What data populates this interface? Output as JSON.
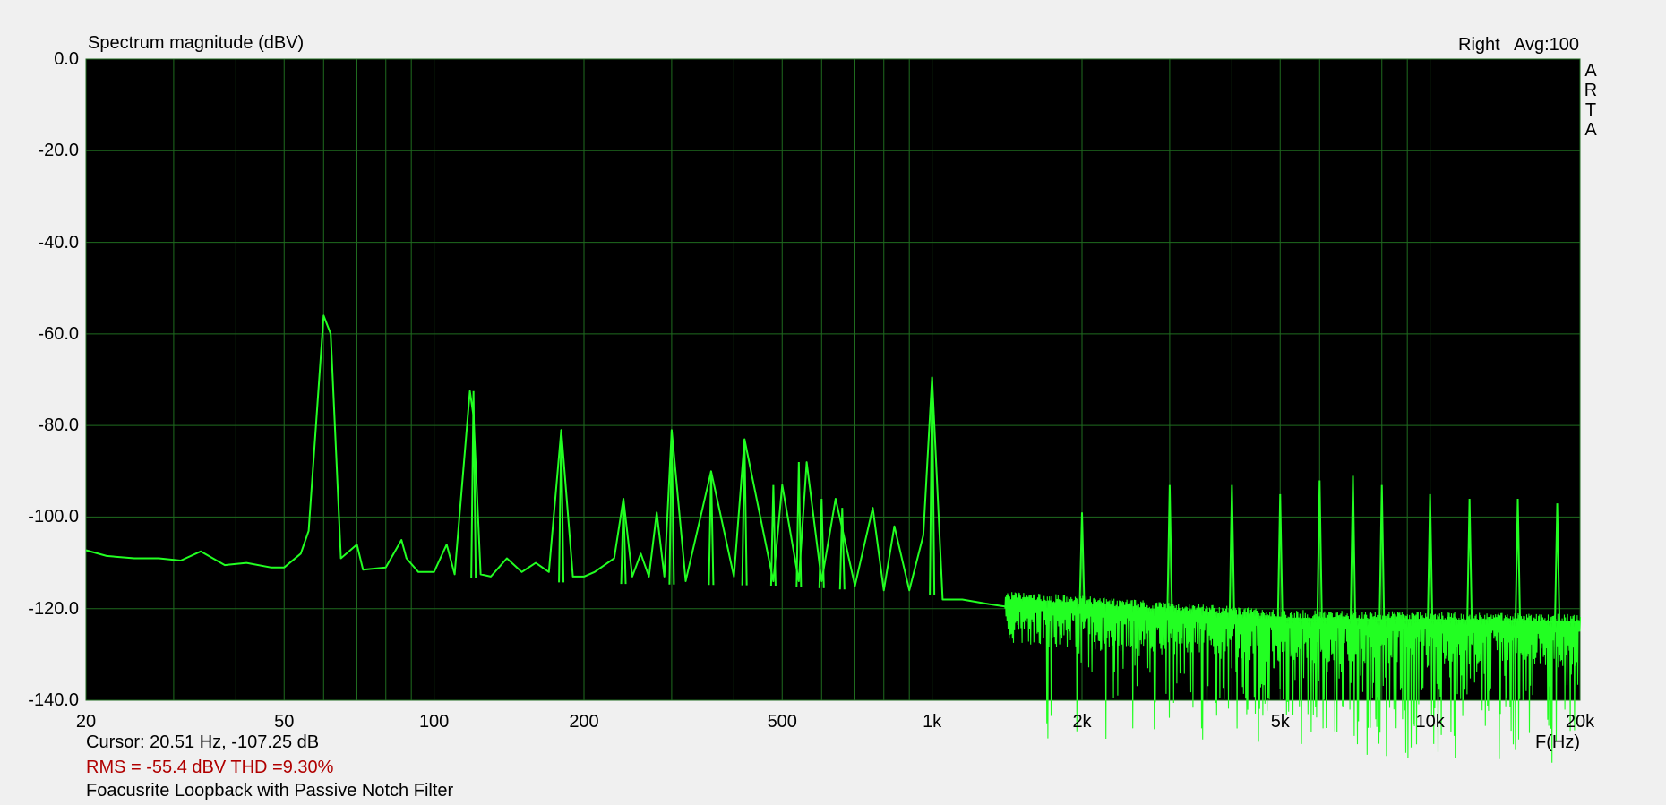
{
  "title": "Spectrum magnitude (dBV)",
  "channel_label": "Right",
  "avg_label": "Avg:100",
  "watermark_letters": [
    "A",
    "R",
    "T",
    "A"
  ],
  "cursor_text": "Cursor: 20.51 Hz, -107.25 dB",
  "rms_thd_text": "RMS =  -55.4 dBV  THD =9.30%",
  "measurement_name": "Foacusrite Loopback with Passive Notch Filter",
  "colors": {
    "plot_background": "#000000",
    "grid": "#1f6b1f",
    "trace": "#22ff22",
    "rms_text": "#b00000"
  },
  "chart_data": {
    "type": "line",
    "title": "Spectrum magnitude (dBV)",
    "xlabel": "F(Hz)",
    "ylabel": "",
    "x_scale": "log",
    "xlim": [
      20,
      20000
    ],
    "ylim": [
      -140,
      0
    ],
    "y_ticks": [
      0,
      -20,
      -40,
      -60,
      -80,
      -100,
      -120,
      -140
    ],
    "y_tick_labels": [
      "0.0",
      "-20.0",
      "-40.0",
      "-60.0",
      "-80.0",
      "-100.0",
      "-120.0",
      "-140.0"
    ],
    "x_tick_values": [
      20,
      50,
      100,
      200,
      500,
      1000,
      2000,
      5000,
      10000,
      20000
    ],
    "x_tick_labels": [
      "20",
      "50",
      "100",
      "200",
      "500",
      "1k",
      "2k",
      "5k",
      "10k",
      "20k"
    ],
    "grid": true,
    "noise_floor": [
      [
        20,
        -108.5
      ],
      [
        25,
        -109
      ],
      [
        30,
        -110
      ],
      [
        40,
        -110.5
      ],
      [
        50,
        -111
      ],
      [
        100,
        -113
      ],
      [
        200,
        -114.5
      ],
      [
        500,
        -115
      ],
      [
        1000,
        -117
      ],
      [
        2000,
        -119
      ],
      [
        5000,
        -122
      ],
      [
        10000,
        -122.5
      ],
      [
        20000,
        -123
      ]
    ],
    "series": [
      {
        "name": "",
        "x": [
          20,
          22,
          25,
          28,
          31,
          34,
          38,
          42,
          47,
          50,
          54,
          56,
          60,
          62,
          65,
          70,
          72,
          80,
          86,
          88,
          93,
          100,
          106,
          110,
          118,
          120,
          124,
          130,
          140,
          150,
          160,
          170,
          180,
          190,
          200,
          210,
          230,
          240,
          250,
          260,
          270,
          280,
          290,
          300,
          320,
          360,
          400,
          420,
          480,
          500,
          540,
          560,
          600,
          640,
          700,
          760,
          800,
          840,
          900,
          960,
          1000,
          1050,
          1150,
          1300,
          1500,
          2000,
          3000,
          5000,
          10000,
          20000
        ],
        "y": [
          -107.25,
          -108.5,
          -109,
          -109,
          -109.5,
          -107.5,
          -110.5,
          -110,
          -111,
          -111,
          -108,
          -103,
          -56,
          -60,
          -109,
          -106,
          -111.5,
          -111,
          -105,
          -109,
          -112,
          -112,
          -106,
          -112.5,
          -72.5,
          -78,
          -112.5,
          -113,
          -109,
          -112,
          -110,
          -112,
          -81,
          -113,
          -113,
          -112,
          -109,
          -96,
          -113,
          -108,
          -113,
          -99,
          -113,
          -81,
          -114,
          -90,
          -113,
          -83,
          -114,
          -93,
          -114,
          -88,
          -114,
          -96,
          -115,
          -98,
          -116,
          -102,
          -116,
          -104,
          -69.5,
          -118,
          -118,
          -119,
          -120,
          -121,
          -122,
          -122.5,
          -122.5,
          -123
        ]
      }
    ],
    "harmonic_spikes": {
      "x": [
        120,
        180,
        240,
        300,
        360,
        420,
        480,
        540,
        600,
        660,
        1000,
        2000,
        3000,
        4000,
        5000,
        6000,
        7000,
        8000,
        10000,
        12000,
        15000,
        18000
      ],
      "y": [
        -72.5,
        -81,
        -96,
        -81,
        -90,
        -83,
        -93,
        -88,
        -96,
        -98,
        -69.5,
        -99,
        -93,
        -93,
        -95,
        -92,
        -91,
        -93,
        -95,
        -96,
        -96,
        -97
      ]
    }
  }
}
